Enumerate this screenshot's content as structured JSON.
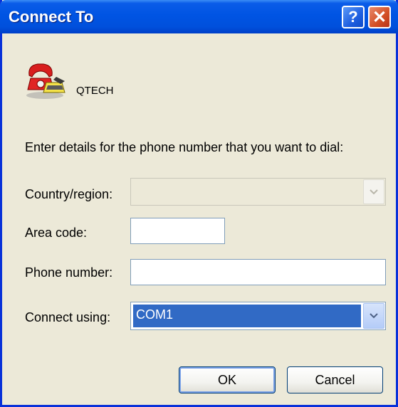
{
  "dialog": {
    "title": "Connect To",
    "help_label": "?",
    "close_label": "✕",
    "connection_name": "QTECH",
    "instructions": "Enter details for the phone number that you want to dial:"
  },
  "fields": {
    "country_label": "Country/region:",
    "country_value": "",
    "area_code_label": "Area code:",
    "area_code_value": "",
    "phone_label": "Phone number:",
    "phone_value": "",
    "connect_using_label": "Connect using:",
    "connect_using_value": "COM1"
  },
  "buttons": {
    "ok": "OK",
    "cancel": "Cancel"
  },
  "colors": {
    "titlebar": "#0054E3",
    "selection": "#316AC5",
    "dialog_bg": "#ECE9D8",
    "close_button": "#D24E24"
  }
}
